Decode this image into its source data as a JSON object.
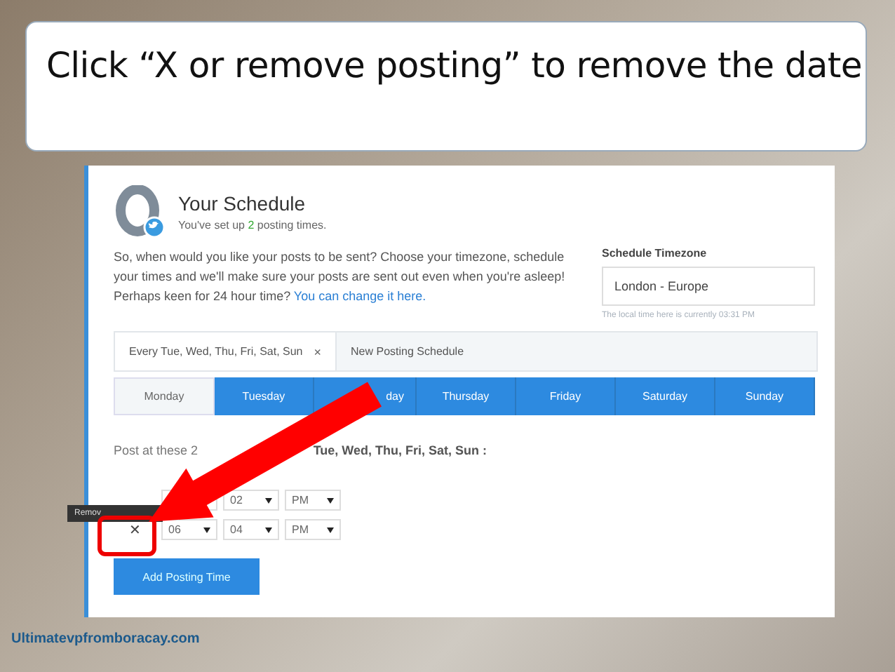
{
  "title": "Click “X or remove posting” to remove the date",
  "schedule": {
    "heading": "Your Schedule",
    "subtitle_prefix": "You've set up ",
    "posting_count": "2",
    "subtitle_suffix": " posting times.",
    "intro": "So, when would you like your posts to be sent? Choose your timezone, schedule your times and we'll make sure your posts are sent out even when you're asleep!",
    "hint": "Perhaps keen for 24 hour time?",
    "hint_link": "You can change it here."
  },
  "timezone": {
    "label": "Schedule Timezone",
    "value": "London - Europe",
    "note": "The local time here is currently 03:31 PM"
  },
  "schedule_tabs": [
    {
      "label": "Every Tue, Wed, Thu, Fri, Sat, Sun",
      "close": "×",
      "selected": true
    },
    {
      "label": "New Posting Schedule",
      "selected": false
    }
  ],
  "days": [
    {
      "label": "Monday",
      "selected": false
    },
    {
      "label": "Tuesday",
      "selected": true
    },
    {
      "label": "day",
      "selected": true
    },
    {
      "label": "Thursday",
      "selected": true
    },
    {
      "label": "Friday",
      "selected": true
    },
    {
      "label": "Saturday",
      "selected": true
    },
    {
      "label": "Sunday",
      "selected": true
    }
  ],
  "post_at_prefix": "Post at these 2",
  "post_at_days": "Tue, Wed, Thu, Fri, Sat, Sun :",
  "tooltip": "Remov",
  "times": [
    {
      "fields": [
        {
          "kind": "blank"
        },
        {
          "kind": "select",
          "value": "02"
        },
        {
          "kind": "select",
          "value": "PM"
        }
      ]
    },
    {
      "remove": "✕",
      "fields": [
        {
          "kind": "select",
          "value": "06"
        },
        {
          "kind": "select",
          "value": "04"
        },
        {
          "kind": "select",
          "value": "PM"
        }
      ]
    }
  ],
  "add_button": "Add Posting Time",
  "footer": "Ultimatevpfromboracay.com"
}
